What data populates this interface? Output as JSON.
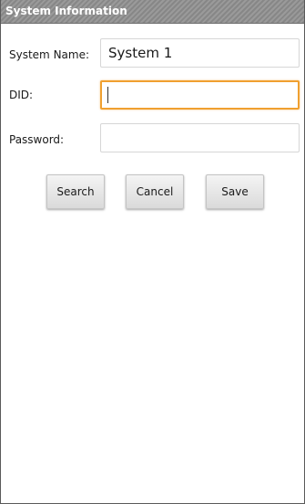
{
  "window": {
    "title": "System Information"
  },
  "form": {
    "system_name": {
      "label": "System Name:",
      "value": "System 1"
    },
    "did": {
      "label": "DID:",
      "value": ""
    },
    "password": {
      "label": "Password:",
      "value": ""
    }
  },
  "buttons": {
    "search_label": "Search",
    "cancel_label": "Cancel",
    "save_label": "Save"
  },
  "colors": {
    "title_bar": "#8f8f8f",
    "focus_border": "#f0a030"
  }
}
